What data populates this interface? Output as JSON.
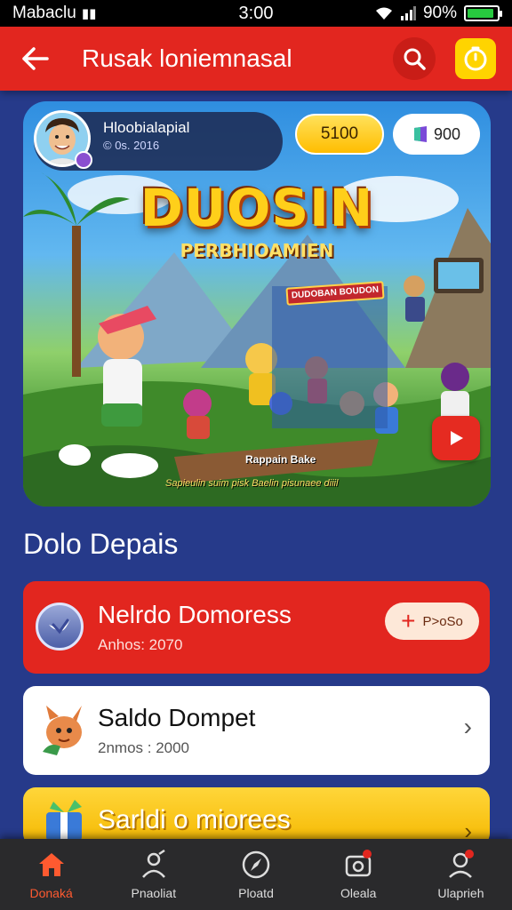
{
  "status_bar": {
    "carrier": "Mabaclu",
    "time": "3:00",
    "battery": "90%",
    "battery_level": 0.9
  },
  "header": {
    "title": "Rusak loniemnasal"
  },
  "hero": {
    "profile_name": "Hloobialapial",
    "profile_sub": "© 0s. 2016",
    "coins": "5100",
    "gems": "900",
    "title": "DUOSIN",
    "subtitle": "PERBHIOAMIEN",
    "banner_text": "DUDOBAN BOUDON",
    "sign_text": "Rappain Bake",
    "footer_text": "Sapieulin suim pisk Baelin pisunaee diiil"
  },
  "section": {
    "title": "Dolo Depais"
  },
  "cards": {
    "primary": {
      "title": "Nelrdo Domoress",
      "subtitle": "Anhos: 2070",
      "button_label": "P>oSo"
    },
    "secondary": {
      "title": "Saldo Dompet",
      "subtitle": "2nmos : 2000"
    },
    "tertiary": {
      "title": "Sarldi o miorees"
    }
  },
  "bottom_nav": [
    {
      "label": "Donaká",
      "icon": "home-icon",
      "active": true
    },
    {
      "label": "Pnaoliat",
      "icon": "person-icon",
      "active": false
    },
    {
      "label": "Ploatd",
      "icon": "compass-icon",
      "active": false
    },
    {
      "label": "Oleala",
      "icon": "camera-icon",
      "active": false
    },
    {
      "label": "Ulaprieh",
      "icon": "profile-icon",
      "active": false
    }
  ],
  "colors": {
    "accent_red": "#e2261f",
    "accent_yellow": "#ffd400",
    "background": "#263a8a",
    "nav_background": "#2a2a2c"
  }
}
